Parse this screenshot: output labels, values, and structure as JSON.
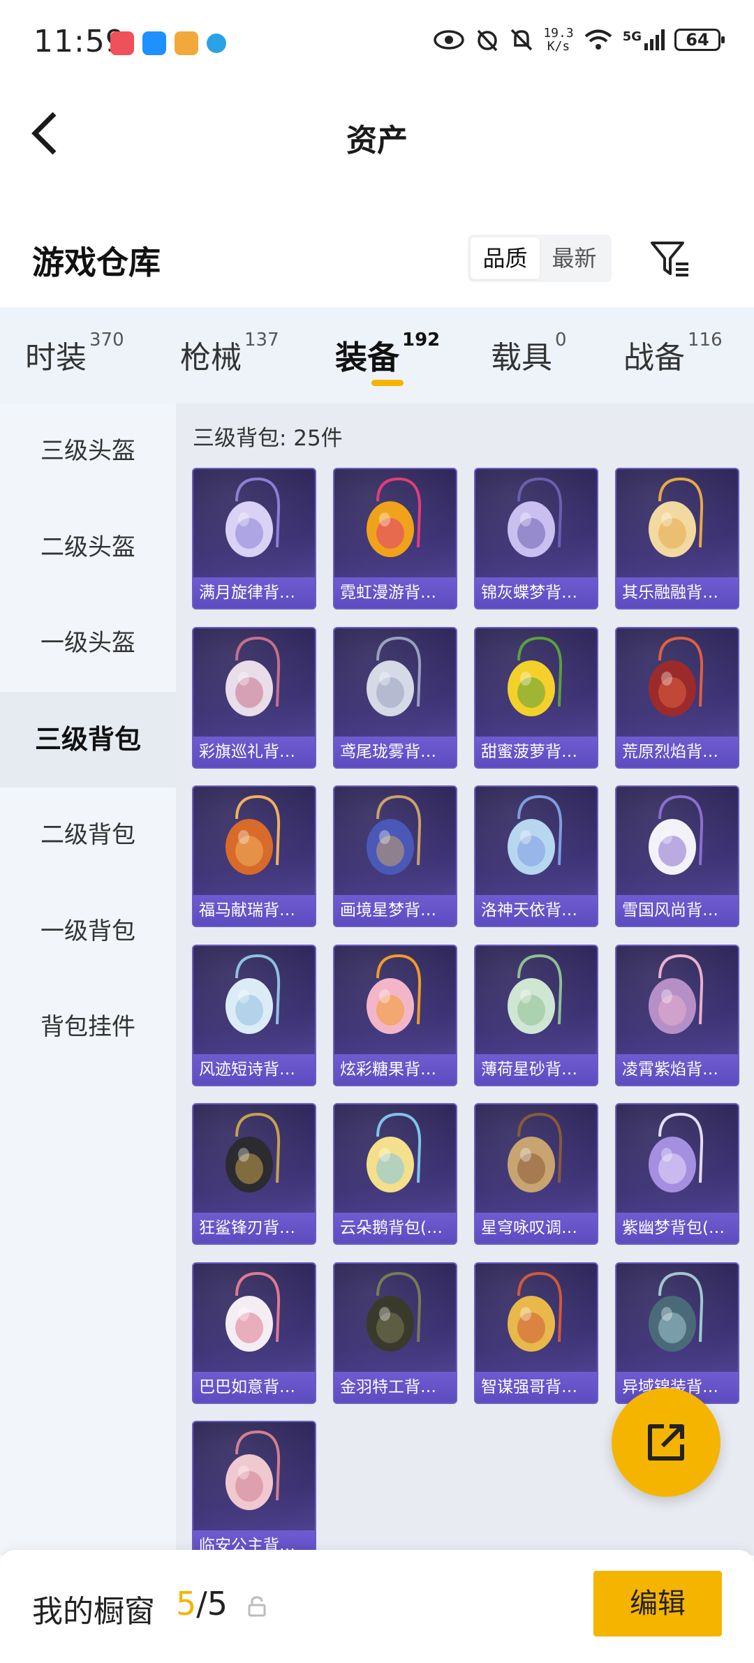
{
  "status_bar": {
    "time": "11:59",
    "net_speed_value": "19.3",
    "net_speed_unit": "K/s",
    "network": "5G",
    "battery": "64"
  },
  "header": {
    "title": "资产"
  },
  "section": {
    "title": "游戏仓库",
    "sort_options": [
      "品质",
      "最新"
    ],
    "sort_selected": "品质"
  },
  "tabs": [
    {
      "label": "时装",
      "count": "370"
    },
    {
      "label": "枪械",
      "count": "137"
    },
    {
      "label": "装备",
      "count": "192"
    },
    {
      "label": "载具",
      "count": "0"
    },
    {
      "label": "战备",
      "count": "116"
    }
  ],
  "active_tab": "装备",
  "sidebar": {
    "items": [
      "三级头盔",
      "二级头盔",
      "一级头盔",
      "三级背包",
      "二级背包",
      "一级背包",
      "背包挂件"
    ],
    "active": "三级背包"
  },
  "content": {
    "count_label": "三级背包: 25件",
    "items": [
      {
        "name": "满月旋律背…",
        "color": "#d9d2f5",
        "accent": "#8b7fd6"
      },
      {
        "name": "霓虹漫游背…",
        "color": "#f0a31a",
        "accent": "#e23d7a"
      },
      {
        "name": "锦灰蝶梦背…",
        "color": "#c9c0ef",
        "accent": "#6b5fb0"
      },
      {
        "name": "其乐融融背…",
        "color": "#f2d9a0",
        "accent": "#e8a84a"
      },
      {
        "name": "彩旗巡礼背…",
        "color": "#e8dde8",
        "accent": "#c86f8a"
      },
      {
        "name": "鸢尾珑雾背…",
        "color": "#d6d9e6",
        "accent": "#9aa0c0"
      },
      {
        "name": "甜蜜菠萝背…",
        "color": "#f4d12a",
        "accent": "#5aa03c"
      },
      {
        "name": "荒原烈焰背…",
        "color": "#9c2a2a",
        "accent": "#e06040"
      },
      {
        "name": "福马献瑞背…",
        "color": "#d86a2a",
        "accent": "#f0b060"
      },
      {
        "name": "画境星梦背…",
        "color": "#4a58b8",
        "accent": "#c9a26a"
      },
      {
        "name": "洛神天依背…",
        "color": "#b7d6f0",
        "accent": "#7f9de0"
      },
      {
        "name": "雪国风尚背…",
        "color": "#f2f2f8",
        "accent": "#8a6fd0"
      },
      {
        "name": "风迹短诗背…",
        "color": "#dcecf7",
        "accent": "#8fc0e0"
      },
      {
        "name": "炫彩糖果背…",
        "color": "#f3b6c8",
        "accent": "#f29a2a"
      },
      {
        "name": "薄荷星砂背…",
        "color": "#cfe6d2",
        "accent": "#8fbf94"
      },
      {
        "name": "凌霄紫焰背…",
        "color": "#b58fc6",
        "accent": "#e8b0d0"
      },
      {
        "name": "狂鲨锋刃背…",
        "color": "#2b2b30",
        "accent": "#c6a24a"
      },
      {
        "name": "云朵鹅背包(…",
        "color": "#f4e08a",
        "accent": "#7fc4e8"
      },
      {
        "name": "星穹咏叹调…",
        "color": "#c8a470",
        "accent": "#8a5a3a"
      },
      {
        "name": "紫幽梦背包(…",
        "color": "#a48fe0",
        "accent": "#e6dcfa"
      },
      {
        "name": "巴巴如意背…",
        "color": "#f4eef4",
        "accent": "#e07a90"
      },
      {
        "name": "金羽特工背…",
        "color": "#3a3a2c",
        "accent": "#7a7a58"
      },
      {
        "name": "智谋强哥背…",
        "color": "#e8b84a",
        "accent": "#d05a3a"
      },
      {
        "name": "异域锦装背…",
        "color": "#4a6a7a",
        "accent": "#a0c8d0"
      },
      {
        "name": "临安公主背…",
        "color": "#f0c8d0",
        "accent": "#d08090"
      }
    ]
  },
  "bottom_bar": {
    "label": "我的橱窗",
    "current": "5",
    "separator": "/",
    "total": "5",
    "edit_label": "编辑"
  },
  "colors": {
    "accent": "#f5b400",
    "card_bg": "#3d3375",
    "card_label_bg": "#6f5cd1"
  }
}
